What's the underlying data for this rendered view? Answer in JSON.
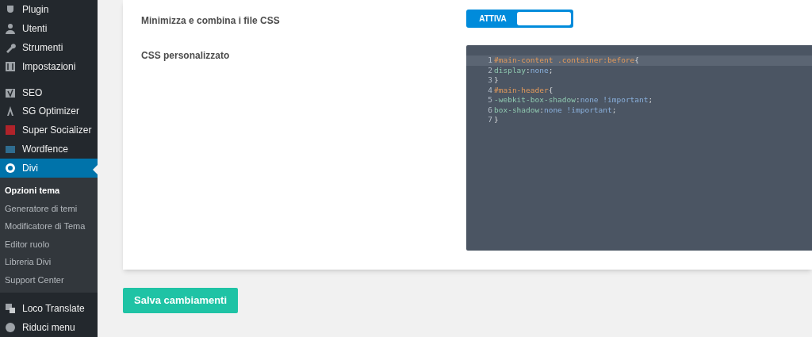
{
  "sidebar": {
    "items": [
      {
        "label": "Plugin",
        "selected": false
      },
      {
        "label": "Utenti",
        "selected": false
      },
      {
        "label": "Strumenti",
        "selected": false
      },
      {
        "label": "Impostazioni",
        "selected": false
      },
      {
        "label": "SEO",
        "selected": false
      },
      {
        "label": "SG Optimizer",
        "selected": false
      },
      {
        "label": "Super Socializer",
        "selected": false
      },
      {
        "label": "Wordfence",
        "selected": false
      },
      {
        "label": "Divi",
        "selected": true,
        "children": [
          {
            "label": "Opzioni tema",
            "selected": true
          },
          {
            "label": "Generatore di temi",
            "selected": false
          },
          {
            "label": "Modificatore di Tema",
            "selected": false
          },
          {
            "label": "Editor ruolo",
            "selected": false
          },
          {
            "label": "Libreria Divi",
            "selected": false
          },
          {
            "label": "Support Center",
            "selected": false
          }
        ]
      },
      {
        "label": "Loco Translate",
        "selected": false
      },
      {
        "label": "Riduci menu",
        "selected": false
      }
    ]
  },
  "settings": [
    {
      "kind": "toggle",
      "label": "Minimizza e combina i file CSS",
      "toggle_label": "ATTIVA",
      "on": true
    },
    {
      "kind": "code",
      "label": "CSS personalizzato",
      "lines": [
        {
          "number": "1",
          "active": true,
          "tokens": [
            {
              "kind": "selector",
              "text": "#main-content .container:before"
            },
            {
              "kind": "punct",
              "text": "{"
            }
          ]
        },
        {
          "number": "2",
          "active": false,
          "tokens": [
            {
              "kind": "property",
              "text": "display"
            },
            {
              "kind": "punct",
              "text": ":"
            },
            {
              "kind": "value",
              "text": "none"
            },
            {
              "kind": "punct",
              "text": ";"
            }
          ]
        },
        {
          "number": "3",
          "active": false,
          "tokens": [
            {
              "kind": "punct",
              "text": "}"
            }
          ]
        },
        {
          "number": "4",
          "active": false,
          "tokens": [
            {
              "kind": "selector",
              "text": "#main-header"
            },
            {
              "kind": "punct",
              "text": "{"
            }
          ]
        },
        {
          "number": "5",
          "active": false,
          "tokens": [
            {
              "kind": "property",
              "text": "-webkit-box-shadow"
            },
            {
              "kind": "punct",
              "text": ":"
            },
            {
              "kind": "value",
              "text": "none !important"
            },
            {
              "kind": "punct",
              "text": ";"
            }
          ]
        },
        {
          "number": "6",
          "active": false,
          "tokens": [
            {
              "kind": "property",
              "text": "box-shadow"
            },
            {
              "kind": "punct",
              "text": ":"
            },
            {
              "kind": "value",
              "text": "none !important"
            },
            {
              "kind": "punct",
              "text": ";"
            }
          ]
        },
        {
          "number": "7",
          "active": false,
          "tokens": [
            {
              "kind": "punct",
              "text": "}"
            }
          ]
        }
      ]
    }
  ],
  "save_button": "Salva cambiamenti"
}
